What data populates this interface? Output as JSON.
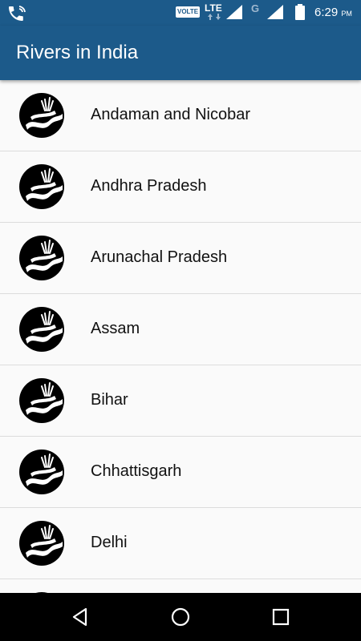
{
  "status_bar": {
    "left_icon": "phone-wifi-icon",
    "volte": "VOLTE",
    "lte": "LTE",
    "network_g": "G",
    "time": "6:29",
    "ampm": "PM"
  },
  "app_bar": {
    "title": "Rivers in India"
  },
  "list": {
    "items": [
      {
        "label": "Andaman and Nicobar",
        "icon": "river-icon"
      },
      {
        "label": "Andhra Pradesh",
        "icon": "river-icon"
      },
      {
        "label": "Arunachal Pradesh",
        "icon": "river-icon"
      },
      {
        "label": "Assam",
        "icon": "river-icon"
      },
      {
        "label": "Bihar",
        "icon": "river-icon"
      },
      {
        "label": "Chhattisgarh",
        "icon": "river-icon"
      },
      {
        "label": "Delhi",
        "icon": "river-icon"
      },
      {
        "label": "",
        "icon": "river-icon"
      }
    ]
  },
  "nav_bar": {
    "back": "back-icon",
    "home": "home-icon",
    "recent": "recent-apps-icon"
  },
  "colors": {
    "primary": "#1c5a8a",
    "list_bg": "#fafafa",
    "divider": "#dcdcdc"
  }
}
